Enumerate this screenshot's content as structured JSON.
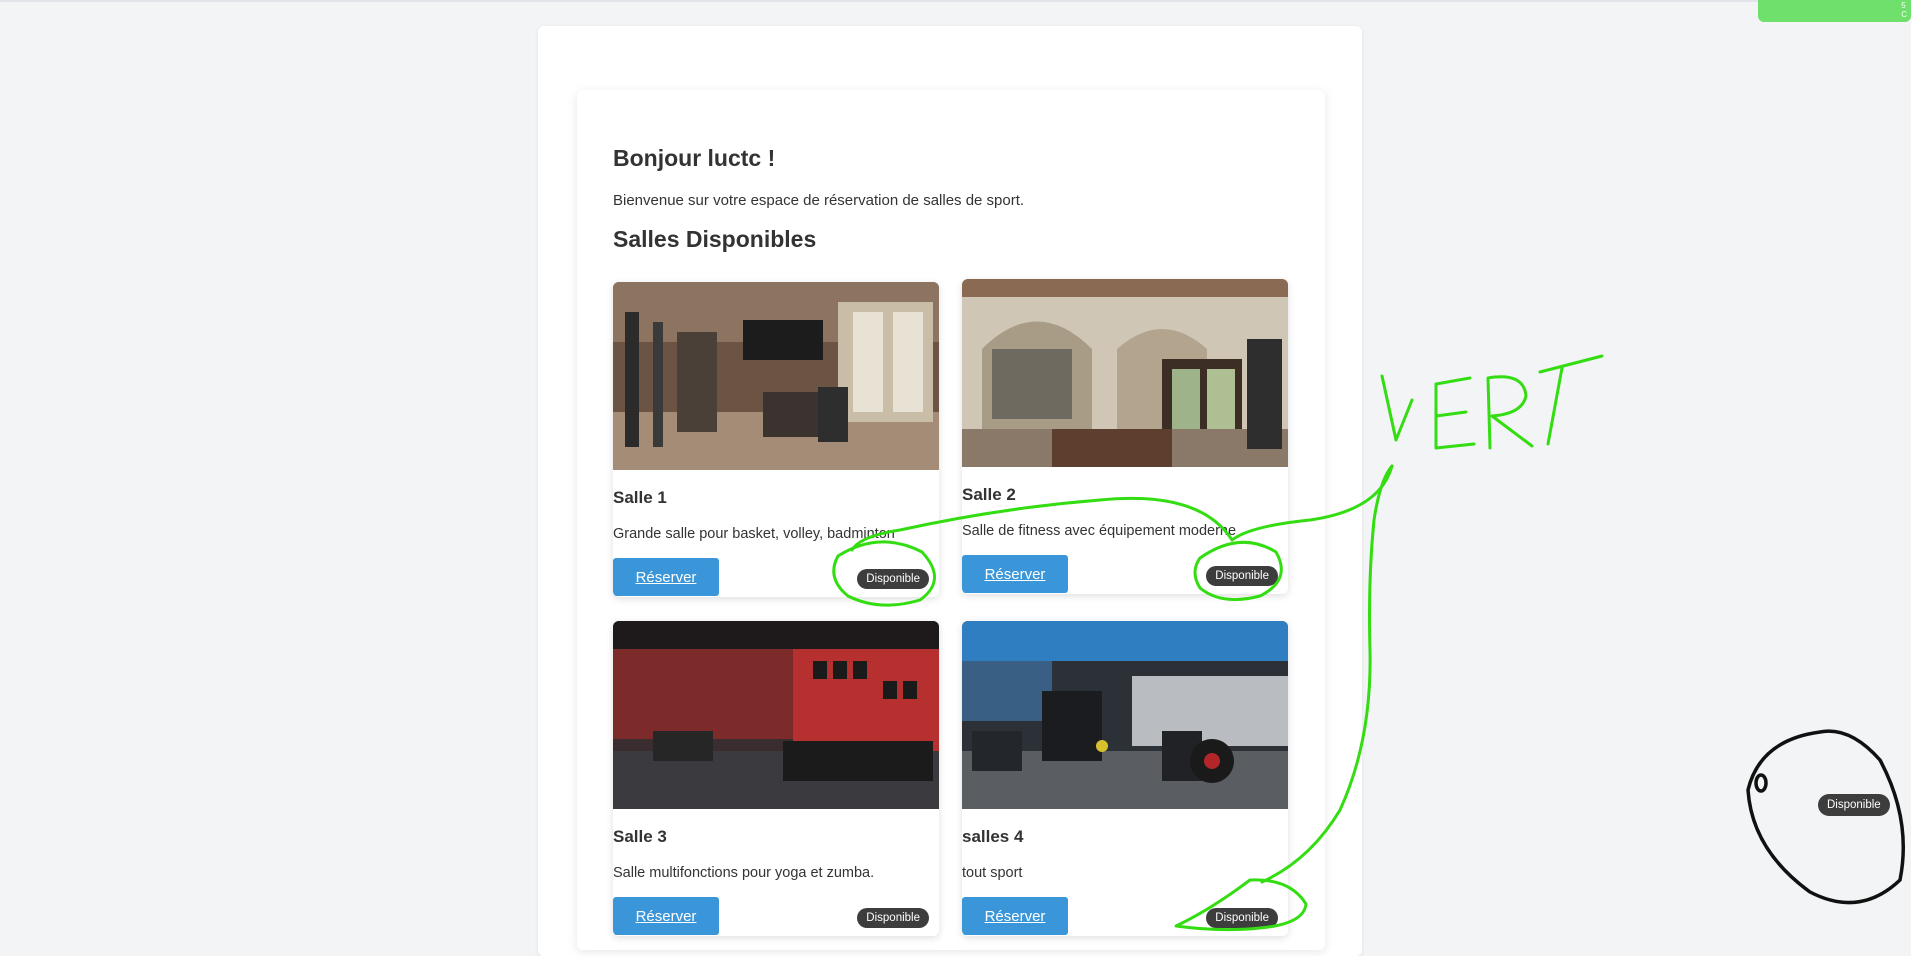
{
  "page": {
    "greeting": "Bonjour luctc !",
    "welcome": "Bienvenue sur votre espace de réservation de salles de sport.",
    "section_title": "Salles Disponibles"
  },
  "rooms": [
    {
      "name": "Salle 1",
      "description": "Grande salle pour basket, volley, badminton",
      "button": "Réserver",
      "status": "Disponible"
    },
    {
      "name": "Salle 2",
      "description": "Salle de fitness avec équipement moderne",
      "button": "Réserver",
      "status": "Disponible"
    },
    {
      "name": "Salle 3",
      "description": "Salle multifonctions pour yoga et zumba.",
      "button": "Réserver",
      "status": "Disponible"
    },
    {
      "name": "salles 4",
      "description": "tout sport",
      "button": "Réserver",
      "status": "Disponible"
    }
  ],
  "floating_badge": "Disponible",
  "annotation": {
    "word": "VERT",
    "mark": "0",
    "color": "#33dd11"
  },
  "colors": {
    "button": "#3a96d9",
    "badge": "#3d3d3d",
    "toast": "#6fe06c"
  }
}
